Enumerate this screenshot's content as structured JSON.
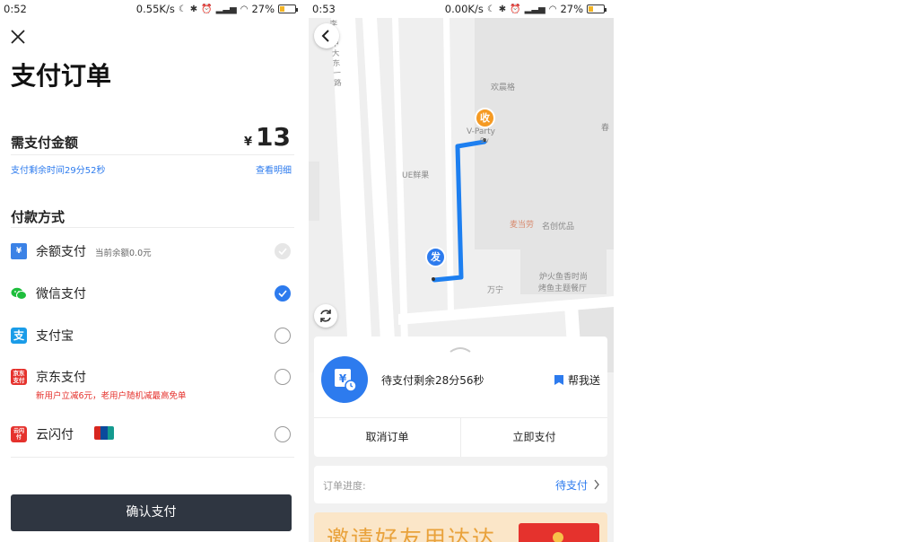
{
  "left_screen": {
    "status_bar": {
      "time": "0:52",
      "speed": "0.55K/s",
      "battery": "27%"
    },
    "title": "支付订单",
    "amount": {
      "label": "需支付金额",
      "currency": "¥",
      "value": "13"
    },
    "remaining_time": "支付剩余时间29分52秒",
    "details_link": "查看明细",
    "payment_section_title": "付款方式",
    "methods": [
      {
        "label": "余额支付",
        "note": "当前余额0.0元",
        "icon": "wallet-icon",
        "state": "disabled"
      },
      {
        "label": "微信支付",
        "note": "",
        "icon": "wechat-icon",
        "state": "checked"
      },
      {
        "label": "支付宝",
        "note": "",
        "icon": "alipay-icon",
        "state": "unchecked"
      },
      {
        "label": "京东支付",
        "note": "新用户立减6元，老用户随机减最高免单",
        "icon": "jd-pay-icon",
        "state": "unchecked"
      },
      {
        "label": "云闪付",
        "note": "",
        "icon": "unionpay-icon",
        "state": "unchecked"
      }
    ],
    "confirm_button": "确认支付",
    "colors": {
      "accent": "#2d7bee",
      "promo_red": "#e5322d",
      "button_dark": "#2f3641"
    }
  },
  "right_screen": {
    "status_bar": {
      "time": "0:53",
      "speed": "0.00K/s",
      "battery": "27%"
    },
    "map": {
      "labels": {
        "road": "李城中大东一路",
        "place1": "欢晨格",
        "place2": "V-Party",
        "place2b": "9v",
        "place3": "UE鲜果",
        "place4": "麦当劳",
        "place5": "名创优品",
        "place6": "万宁",
        "place7": "炉火鱼香时尚",
        "place7b": "烤鱼主题餐厅",
        "place8": "春"
      },
      "receive_marker": "收",
      "send_marker": "发",
      "route_color": "#1d7ff0"
    },
    "status_card": {
      "icon": "yuan-clock-icon",
      "text": "待支付剩余28分56秒",
      "help_link": "帮我送",
      "cancel_button": "取消订单",
      "pay_button": "立即支付"
    },
    "progress": {
      "label": "订单进度:",
      "value": "待支付"
    },
    "banner_text": "邀请好友用达达"
  }
}
